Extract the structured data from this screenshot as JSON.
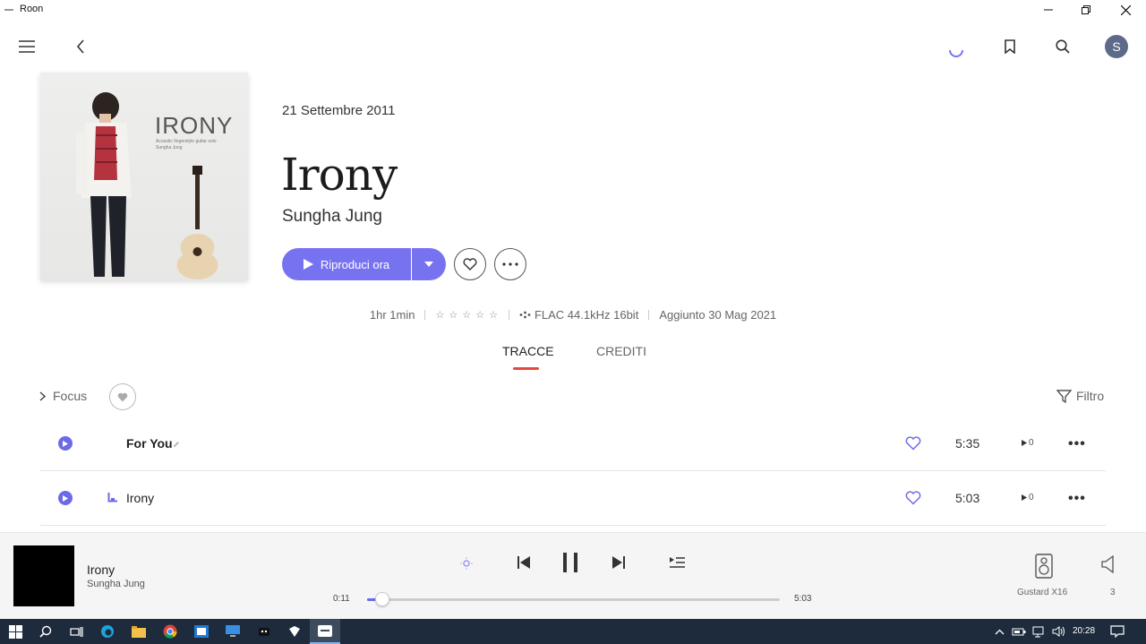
{
  "window": {
    "title": "Roon"
  },
  "album": {
    "release_date": "21 Settembre 2011",
    "title": "Irony",
    "artist": "Sungha Jung",
    "cover_title": "IRONY",
    "cover_subtitle": "Acoustic fingerstyle guitar solo",
    "cover_artist": "Sungha Jung",
    "play_label": "Riproduci ora",
    "duration": "1hr 1min",
    "rating": 0,
    "format": "FLAC 44.1kHz 16bit",
    "added": "Aggiunto 30 Mag 2021"
  },
  "tabs": [
    {
      "label": "TRACCE",
      "active": true
    },
    {
      "label": "CREDITI",
      "active": false
    }
  ],
  "toolbar": {
    "focus_label": "Focus",
    "filter_label": "Filtro"
  },
  "tracks": [
    {
      "title": "For You",
      "duration": "5:35",
      "plays": "0",
      "favorite": false
    },
    {
      "title": "Irony",
      "duration": "5:03",
      "plays": "0",
      "favorite": false
    }
  ],
  "now_playing": {
    "title": "Irony",
    "artist": "Sungha Jung",
    "elapsed": "0:11",
    "total": "5:03",
    "progress": 0.036,
    "zone": "Gustard X16",
    "volume": "3"
  },
  "taskbar": {
    "time": "20:28"
  },
  "colors": {
    "accent": "#7773f0",
    "tab_underline": "#e8483e",
    "taskbar": "#1d2b3c"
  }
}
